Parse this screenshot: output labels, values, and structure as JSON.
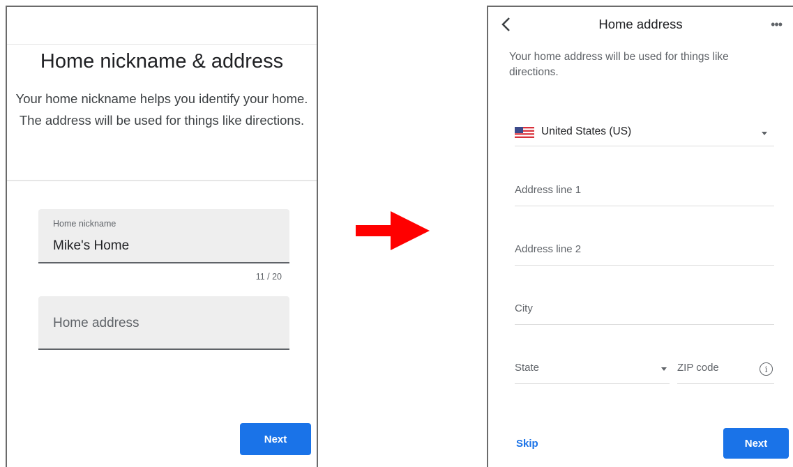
{
  "left_screen": {
    "title": "Home nickname & address",
    "description": "Your home nickname helps you identify your home. The address will be used for things like directions.",
    "nickname_field": {
      "label": "Home nickname",
      "value": "Mike's Home",
      "counter": "11 / 20"
    },
    "address_field": {
      "placeholder": "Home address"
    },
    "next_button": "Next"
  },
  "arrow": {
    "color": "#ff0000",
    "icon": "right-arrow-icon"
  },
  "right_screen": {
    "title": "Home address",
    "back_icon": "chevron-left-icon",
    "more_icon": "more-horizontal-icon",
    "more_glyph": "•••",
    "description": "Your home address will be used for things like directions.",
    "country": {
      "flag": "us-flag-icon",
      "value": "United States (US)"
    },
    "fields": {
      "address_line_1": "Address line 1",
      "address_line_2": "Address line 2",
      "city": "City",
      "state": "State",
      "zip": "ZIP code"
    },
    "info_glyph": "i",
    "skip_label": "Skip",
    "next_button": "Next"
  },
  "colors": {
    "accent": "#1a73e8",
    "field_bg": "#eeeeee"
  }
}
